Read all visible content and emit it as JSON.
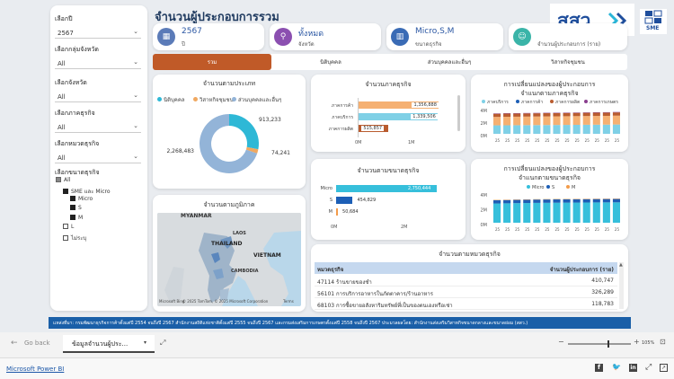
{
  "page_title": "จำนวนผู้ประกอบการรวม",
  "brand": {
    "logo_text": "สสว",
    "sme_logo_text": "SME"
  },
  "filters": [
    {
      "label": "เลือกปี",
      "value": "2567"
    },
    {
      "label": "เลือกกลุ่มจังหวัด",
      "value": "All"
    },
    {
      "label": "เลือกจังหวัด",
      "value": "All"
    },
    {
      "label": "เลือกภาคธุรกิจ",
      "value": "All"
    },
    {
      "label": "เลือกหมวดธุรกิจ",
      "value": "All"
    }
  ],
  "size_filter": {
    "label": "เลือกขนาดธุรกิจ",
    "items": [
      "All",
      "SME และ Micro",
      "Micro",
      "S",
      "M",
      "L",
      "ไม่ระบุ"
    ]
  },
  "kpis": [
    {
      "value": "2567",
      "sub": "ปี",
      "icon": "calendar-icon"
    },
    {
      "value": "ทั้งหมด",
      "sub": "จังหวัด",
      "icon": "location-pin-icon"
    },
    {
      "value": "Micro,S,M",
      "sub": "ขนาดธุรกิจ",
      "icon": "building-icon"
    },
    {
      "value": "",
      "sub": "จำนวนผู้ประกอบการ (ราย)",
      "icon": "people-icon"
    }
  ],
  "tabs": [
    "รวม",
    "นิติบุคคล",
    "ส่วนบุคคลและอื่นๆ",
    "วิสาหกิจชุมชน"
  ],
  "colors": {
    "tab_active": "#c05a28",
    "juristic": "#2eb8d6",
    "community": "#f0a860",
    "individual": "#93b4d8",
    "services": "#7fd0e6",
    "trade": "#f5b072",
    "production": "#b95c2f",
    "micro": "#36bfdb",
    "s": "#1d5fb6",
    "m": "#f39c4a"
  },
  "donut_card": {
    "title": "จำนวนตามประเภท",
    "legend": [
      "นิติบุคคล",
      "วิสาหกิจชุมชน",
      "ส่วนบุคคลและอื่นๆ"
    ],
    "labels": [
      "913,233",
      "74,241",
      "2,268,483"
    ]
  },
  "sector_card": {
    "title": "จำนวนภาคธุรกิจ",
    "axis": [
      "0M",
      "1M"
    ]
  },
  "size_card": {
    "title": "จำนวนตามขนาดธุรกิจ",
    "axis": [
      "0M",
      "2M"
    ]
  },
  "trend_sector_card": {
    "title": "การเปลี่ยนแปลงของผู้ประกอบการ",
    "subtitle": "จำแนกตามภาคธุรกิจ",
    "legend": [
      "ภาคบริการ",
      "ภาคการค้า",
      "ภาคการผลิต",
      "ภาคการเกษตร"
    ],
    "yticks": [
      "4M",
      "2M",
      "0M"
    ]
  },
  "trend_size_card": {
    "title": "การเปลี่ยนแปลงของผู้ประกอบการ",
    "subtitle": "จำแนกตามขนาดธุรกิจ",
    "legend": [
      "Micro",
      "S",
      "M"
    ],
    "yticks": [
      "4M",
      "2M",
      "0M"
    ]
  },
  "map_card": {
    "title": "จำนวนตามภูมิภาค",
    "labels": [
      "MYANMAR",
      "THAILAND",
      "LAOS",
      "VIETNAM",
      "CAMBODIA"
    ],
    "attribution": "© 2025 TomTom, © 2025 Microsoft Corporation",
    "terms": "Terms",
    "bing": "Microsoft Bing"
  },
  "table_card": {
    "title": "จำนวนตามหมวดธุรกิจ",
    "columns": [
      "หมวดธุรกิจ",
      "จำนวนผู้ประกอบการ (ราย)"
    ],
    "rows": [
      {
        "name": "47114 ร้านขายของชำ",
        "value": "410,747"
      },
      {
        "name": "56101 การบริการอาหารในภัตตาคาร/ร้านอาหาร",
        "value": "326,289"
      },
      {
        "name": "68103 การซื้อขายอสังหาริมทรัพย์ที่เป็นของตนเองหรือเช่า",
        "value": "118,783"
      }
    ]
  },
  "chart_data": [
    {
      "type": "pie",
      "title": "จำนวนตามประเภท",
      "categories": [
        "นิติบุคคล",
        "วิสาหกิจชุมชน",
        "ส่วนบุคคลและอื่นๆ"
      ],
      "values": [
        913233,
        74241,
        2268483
      ]
    },
    {
      "type": "bar",
      "title": "จำนวนภาคธุรกิจ",
      "categories": [
        "ภาคการค้า",
        "ภาคบริการ",
        "ภาคการผลิต"
      ],
      "values": [
        1356888,
        1339506,
        515857
      ],
      "value_labels": [
        "1,356,888",
        "1,339,506",
        "515,857"
      ],
      "xlim": [
        0,
        1500000
      ],
      "xticks": [
        "0M",
        "1M"
      ]
    },
    {
      "type": "bar",
      "title": "จำนวนตามขนาดธุรกิจ",
      "categories": [
        "Micro",
        "S",
        "M"
      ],
      "values": [
        2750444,
        454829,
        50684
      ],
      "value_labels": [
        "2,750,444",
        "454,829",
        "50,684"
      ],
      "xlim": [
        0,
        3000000
      ],
      "xticks": [
        "0M",
        "2M"
      ]
    },
    {
      "type": "bar",
      "title": "การเปลี่ยนแปลงของผู้ประกอบการ จำแนกตามภาคธุรกิจ",
      "ylim": [
        0,
        4000000
      ],
      "series": [
        {
          "name": "ภาคบริการ",
          "values": [
            1350000,
            1360000,
            1370000,
            1380000,
            1390000,
            1400000,
            1410000,
            1420000,
            1430000,
            1440000,
            1450000,
            1460000,
            1480000
          ]
        },
        {
          "name": "ภาคการค้า",
          "values": [
            1340000,
            1350000,
            1355000,
            1360000,
            1365000,
            1370000,
            1375000,
            1380000,
            1385000,
            1390000,
            1395000,
            1400000,
            1410000
          ]
        },
        {
          "name": "ภาคการผลิต",
          "values": [
            500000,
            505000,
            505000,
            510000,
            510000,
            512000,
            512000,
            514000,
            514000,
            515000,
            515000,
            516000,
            516000
          ]
        },
        {
          "name": "ภาคการเกษตร",
          "values": [
            60000,
            60000,
            61000,
            61000,
            62000,
            62000,
            63000,
            63000,
            64000,
            64000,
            65000,
            65000,
            66000
          ]
        }
      ]
    },
    {
      "type": "bar",
      "title": "การเปลี่ยนแปลงของผู้ประกอบการ จำแนกตามขนาดธุรกิจ",
      "ylim": [
        0,
        4000000
      ],
      "series": [
        {
          "name": "Micro",
          "values": [
            2600000,
            2620000,
            2640000,
            2660000,
            2680000,
            2690000,
            2700000,
            2710000,
            2720000,
            2730000,
            2740000,
            2745000,
            2750000
          ]
        },
        {
          "name": "S",
          "values": [
            440000,
            442000,
            444000,
            446000,
            448000,
            449000,
            450000,
            451000,
            452000,
            452000,
            453000,
            454000,
            455000
          ]
        },
        {
          "name": "M",
          "values": [
            48000,
            48500,
            49000,
            49000,
            49500,
            49500,
            50000,
            50000,
            50000,
            50200,
            50400,
            50600,
            50700
          ]
        }
      ]
    }
  ],
  "source_text": "แหล่งที่มา: กรมพัฒนาธุรกิจการค้าตั้งแต่ปี 2554 จนถึงปี 2567 สำนักงานสถิติแห่งชาติตั้งแต่ปี 2555 จนถึงปี 2567 และกรมส่งเสริมการเกษตรตั้งแต่ปี 2558 จนถึงปี 2567 ประมวลผลโดย: สำนักงานส่งเสริมวิสาหกิจขนาดกลางและขนาดย่อม (สสว.)",
  "footer": {
    "go_back": "Go back",
    "page_tab": "ข้อมูลจำนวนผู้ประ...",
    "zoom": "105%",
    "powerbi": "Microsoft Power BI"
  }
}
